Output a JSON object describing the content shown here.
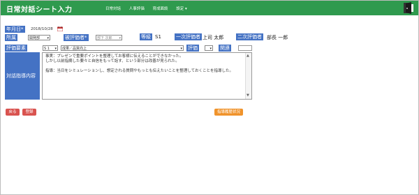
{
  "header": {
    "title": "日常対話シート入力",
    "nav": [
      "日常対話",
      "人事評価",
      "育成面談",
      "設定 ▾"
    ],
    "colors": {
      "bar": "#2f9a4e",
      "label": "#4472c4"
    }
  },
  "form": {
    "date": {
      "label": "年月日*",
      "value": "2018/10/28"
    },
    "dept": {
      "label": "所属",
      "value": "開発部"
    },
    "evaluatee": {
      "label": "被評価者*",
      "value": "部下 次郎"
    },
    "grade": {
      "label": "等級",
      "value": "S1"
    },
    "first_evaluator": {
      "label": "一次評価者",
      "value": "上司 太郎"
    },
    "second_evaluator": {
      "label": "二次評価者",
      "value": "部長 一郎"
    },
    "element": {
      "label": "評価要素",
      "code": "S 1",
      "name": "成果／品質向上"
    },
    "rating": {
      "label": "評価",
      "value": ""
    },
    "related": {
      "label": "関連",
      "value": ""
    },
    "content": {
      "label": "対話指導内容",
      "lines": [
        "事実：プレゼンで重要ポイントを整理してお客様に伝えることができなかった。",
        "しかし以前指摘した要々と自信をもって話す、という部分は改善が見られた。",
        "",
        "指導：当日をシミュレーションし、想定される質問やもっとも伝えたいことを整理しておくことを指導した。"
      ]
    }
  },
  "buttons": {
    "back": "戻る",
    "register": "登録",
    "history": "指導履歴状況"
  }
}
